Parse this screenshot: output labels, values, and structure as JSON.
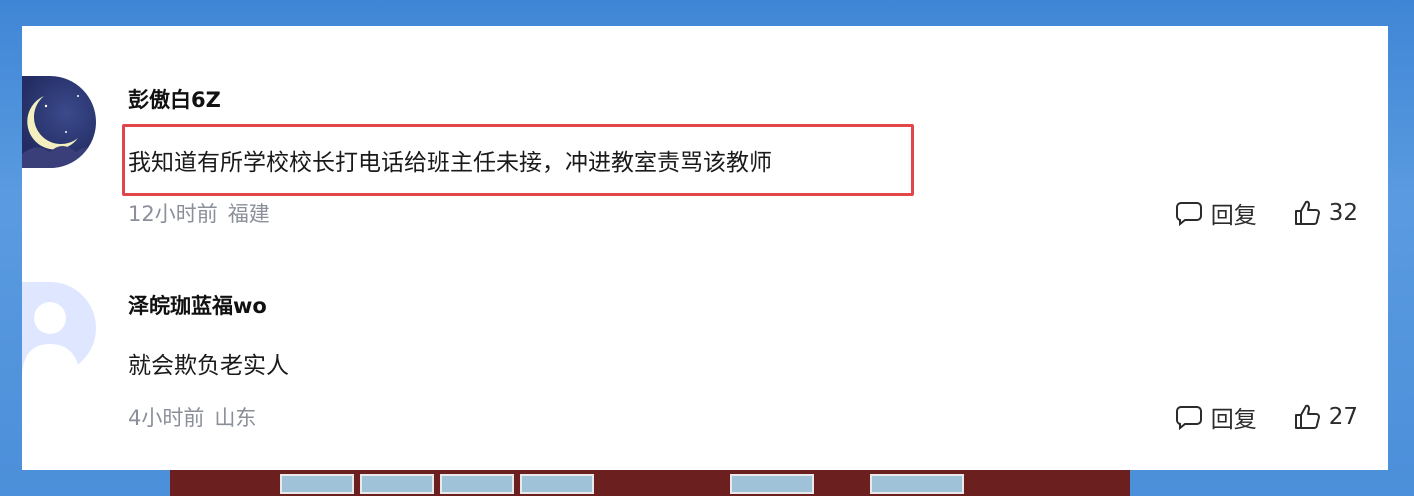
{
  "comments": [
    {
      "username": "彭傲白6Z",
      "text": "我知道有所学校校长打电话给班主任未接，冲进教室责骂该教师",
      "time": "12小时前",
      "location": "福建",
      "reply_label": "回复",
      "likes": "32",
      "highlighted": true
    },
    {
      "username": "泽皖珈蓝福wo",
      "text": "就会欺负老实人",
      "time": "4小时前",
      "location": "山东",
      "reply_label": "回复",
      "likes": "27",
      "highlighted": false
    }
  ],
  "colors": {
    "highlight_border": "#e0464a",
    "meta_text": "#8a8f99",
    "background": "#4c8fda"
  }
}
